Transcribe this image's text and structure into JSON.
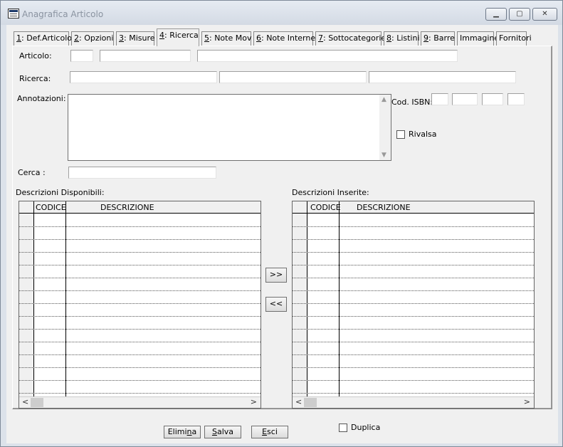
{
  "window": {
    "title": "Anagrafica Articolo"
  },
  "tabs": [
    {
      "key": "1",
      "label": ": Def.Articolo"
    },
    {
      "key": "2",
      "label": ": Opzioni"
    },
    {
      "key": "3",
      "label": ": Misure"
    },
    {
      "key": "4",
      "label": ": Ricerca"
    },
    {
      "key": "5",
      "label": ": Note Mov"
    },
    {
      "key": "6",
      "label": ": Note Internet"
    },
    {
      "key": "7",
      "label": ": Sottocategorie"
    },
    {
      "key": "8",
      "label": ": Listini"
    },
    {
      "key": "9",
      "label": ": Barre"
    },
    {
      "key": "",
      "label": "Immagine"
    },
    {
      "key": "",
      "label": "Fornitori"
    }
  ],
  "active_tab": "4: Ricerca",
  "form": {
    "articolo_label": "Articolo:",
    "ricerca_label": "Ricerca:",
    "annotazioni_label": "Annotazioni:",
    "cod_isbn_label": "Cod. ISBN:",
    "rivalsa_label": "Rivalsa",
    "cerca_label": "Cerca :",
    "articolo_values": [
      "",
      "",
      ""
    ],
    "ricerca_values": [
      "",
      "",
      ""
    ],
    "annotazioni_value": "",
    "isbn_values": [
      "",
      "",
      "",
      ""
    ],
    "cerca_value": ""
  },
  "lists": {
    "disponibili_label": "Descrizioni Disponibili:",
    "inserite_label": "Descrizioni Inserite:",
    "col_codice": "CODICE",
    "col_descrizione": "DESCRIZIONE"
  },
  "transfer": {
    "add_label": ">>",
    "remove_label": "<<"
  },
  "footer": {
    "elimina_pre": "Elimi",
    "elimina_ul": "n",
    "elimina_post": "a",
    "salva_pre": "",
    "salva_ul": "S",
    "salva_post": "alva",
    "esci_pre": "",
    "esci_ul": "E",
    "esci_post": "sci",
    "duplica_label": "Duplica"
  }
}
